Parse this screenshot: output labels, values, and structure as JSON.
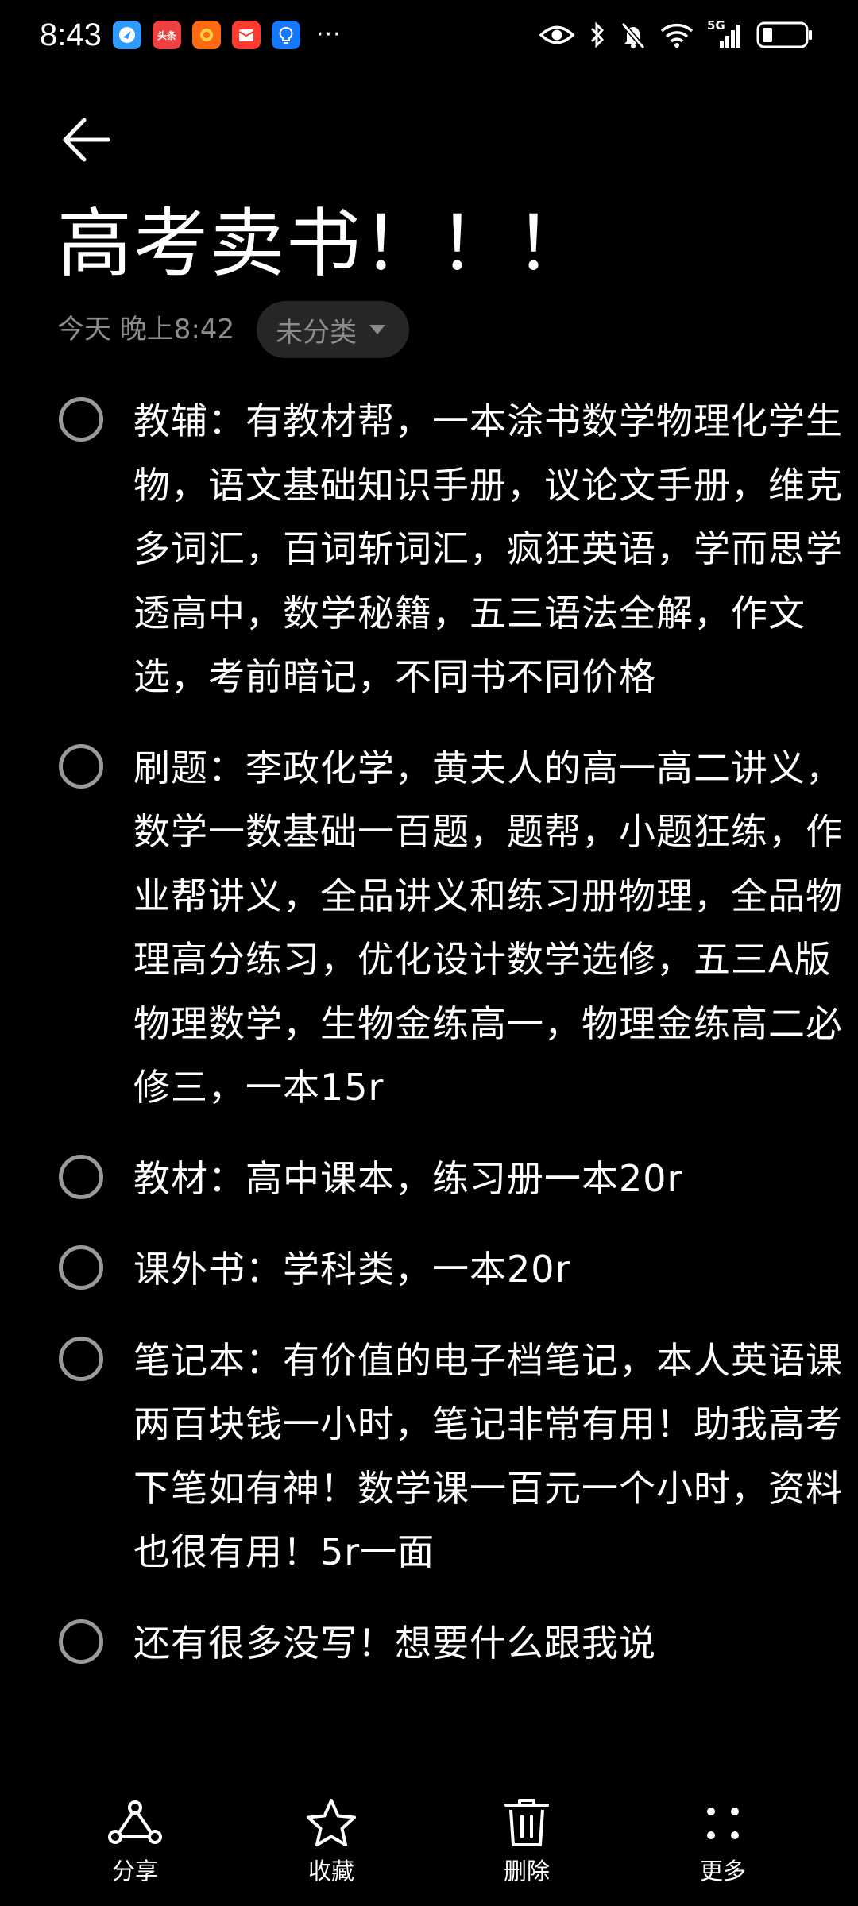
{
  "status_bar": {
    "time": "8:43",
    "app_icons": [
      {
        "name": "browser-app-icon",
        "color": "#2f9bff",
        "glyph": "◎"
      },
      {
        "name": "toutiao-app-icon",
        "color": "#f04142",
        "glyph": "头条"
      },
      {
        "name": "orange-app-icon",
        "color": "#ff6a13",
        "glyph": "✿"
      },
      {
        "name": "red-envelope-app-icon",
        "color": "#ff3b30",
        "glyph": "✉"
      },
      {
        "name": "lightbulb-app-icon",
        "color": "#1677ff",
        "glyph": "✦"
      }
    ],
    "more_indicator": "···",
    "network": "5G"
  },
  "header": {
    "title": "高考卖书！！！",
    "date": "今天 晚上8:42",
    "category": "未分类"
  },
  "checklist": [
    {
      "text": "教辅：有教材帮，一本涂书数学物理化学生物，语文基础知识手册，议论文手册，维克多词汇，百词斩词汇，疯狂英语，学而思学透高中，数学秘籍，五三语法全解，作文选，考前暗记，不同书不同价格",
      "checked": false
    },
    {
      "text": "刷题：李政化学，黄夫人的高一高二讲义，数学一数基础一百题，题帮，小题狂练，作业帮讲义，全品讲义和练习册物理，全品物理高分练习，优化设计数学选修，五三A版物理数学，生物金练高一，物理金练高二必修三，一本15r",
      "checked": false
    },
    {
      "text": "教材：高中课本，练习册一本20r",
      "checked": false
    },
    {
      "text": "课外书：学科类，一本20r",
      "checked": false
    },
    {
      "text": "笔记本：有价值的电子档笔记，本人英语课两百块钱一小时，笔记非常有用！助我高考下笔如有神！数学课一百元一个小时，资料也很有用！5r一面",
      "checked": false
    },
    {
      "text": "还有很多没写！想要什么跟我说",
      "checked": false
    }
  ],
  "toolbar": {
    "share_label": "分享",
    "favorite_label": "收藏",
    "delete_label": "删除",
    "more_label": "更多"
  }
}
